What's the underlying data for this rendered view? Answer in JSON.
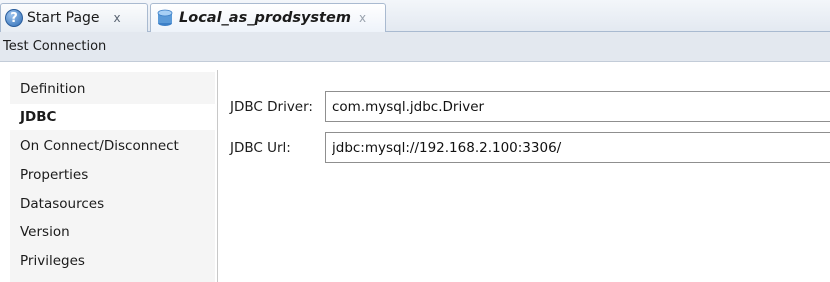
{
  "tabs": [
    {
      "label": "Start Page",
      "close": "x",
      "icon": "help-icon"
    },
    {
      "label": "Local_as_prodsystem",
      "close": "x",
      "icon": "database-icon",
      "active": true
    }
  ],
  "toolbar": {
    "test_connection_label": "Test Connection"
  },
  "nav": {
    "items": [
      {
        "label": "Definition"
      },
      {
        "label": "JDBC",
        "selected": true
      },
      {
        "label": "On Connect/Disconnect"
      },
      {
        "label": "Properties"
      },
      {
        "label": "Datasources"
      },
      {
        "label": "Version"
      },
      {
        "label": "Privileges"
      }
    ]
  },
  "form": {
    "driver_label": "JDBC Driver:",
    "driver_value": "com.mysql.jdbc.Driver",
    "url_label": "JDBC Url:",
    "url_value": "jdbc:mysql://192.168.2.100:3306/"
  },
  "colors": {
    "accent": "#2e6db5",
    "selected_nav": "#ffffff",
    "nav_background": "#f5f5f5"
  }
}
